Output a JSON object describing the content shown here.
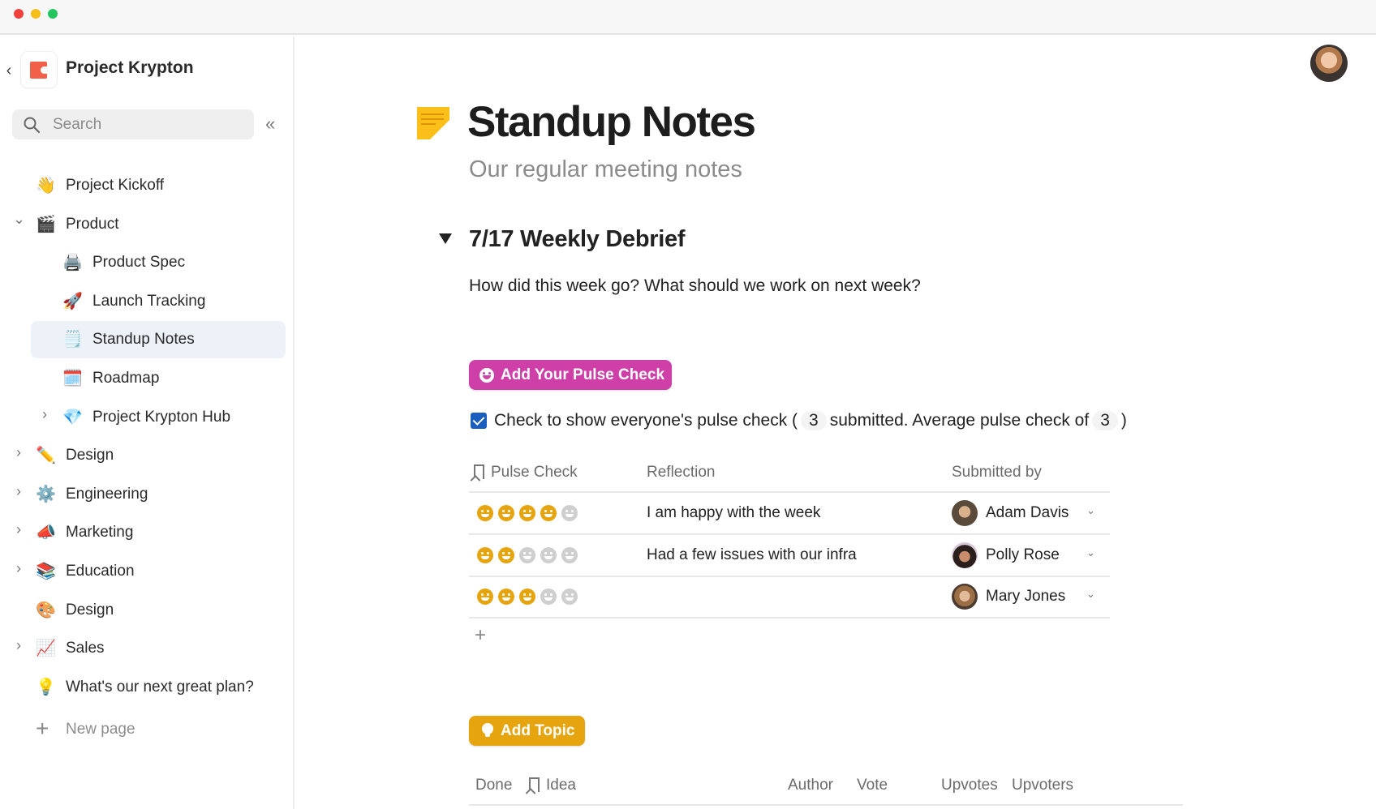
{
  "window": {
    "controls": [
      "close",
      "minimize",
      "zoom"
    ]
  },
  "sidebar": {
    "workspace_name": "Project Krypton",
    "back_icon": "chevron-left-icon",
    "logo_icon": "coda-logo-icon",
    "search_placeholder": "Search",
    "collapse_icon": "double-chevron-left-icon",
    "items": [
      {
        "label": "Project Kickoff",
        "icon": "👋",
        "icon_name": "waving-hand-icon",
        "level": 0,
        "chevron": null,
        "active": false
      },
      {
        "label": "Product",
        "icon": "🎬",
        "icon_name": "clapper-board-icon",
        "level": 0,
        "chevron": "expanded",
        "active": false
      },
      {
        "label": "Product Spec",
        "icon": "🖨️",
        "icon_name": "typewriter-icon",
        "level": 1,
        "chevron": null,
        "active": false
      },
      {
        "label": "Launch Tracking",
        "icon": "🚀",
        "icon_name": "rocket-icon",
        "level": 1,
        "chevron": null,
        "active": false
      },
      {
        "label": "Standup Notes",
        "icon": "🗒️",
        "icon_name": "sticky-note-icon",
        "level": 1,
        "chevron": null,
        "active": true
      },
      {
        "label": "Roadmap",
        "icon": "🗓️",
        "icon_name": "calendar-grid-icon",
        "level": 1,
        "chevron": null,
        "active": false
      },
      {
        "label": "Project Krypton Hub",
        "icon": "💎",
        "icon_name": "gem-icon",
        "level": 1,
        "chevron": "collapsed",
        "active": false
      },
      {
        "label": "Design",
        "icon": "✏️",
        "icon_name": "pencil-ruler-icon",
        "level": 0,
        "chevron": "collapsed",
        "active": false
      },
      {
        "label": "Engineering",
        "icon": "⚙️",
        "icon_name": "gear-icon",
        "level": 0,
        "chevron": "collapsed",
        "active": false
      },
      {
        "label": "Marketing",
        "icon": "📣",
        "icon_name": "megaphone-icon",
        "level": 0,
        "chevron": "collapsed",
        "active": false
      },
      {
        "label": "Education",
        "icon": "📚",
        "icon_name": "books-icon",
        "level": 0,
        "chevron": "collapsed",
        "active": false
      },
      {
        "label": "Design",
        "icon": "🎨",
        "icon_name": "color-grid-icon",
        "level": 0,
        "chevron": null,
        "active": false
      },
      {
        "label": "Sales",
        "icon": "📈",
        "icon_name": "chart-up-icon",
        "level": 0,
        "chevron": "collapsed",
        "active": false
      },
      {
        "label": "What's our next great plan?",
        "icon": "💡",
        "icon_name": "lightbulb-icon",
        "level": 0,
        "chevron": null,
        "active": false
      }
    ],
    "new_page_label": "New page"
  },
  "header": {
    "user_avatar": "user-avatar"
  },
  "page": {
    "title": "Standup Notes",
    "subtitle": "Our regular meeting notes",
    "section": {
      "title": "7/17 Weekly Debrief",
      "expanded": true,
      "prompt": "How did this week go? What should we work on next week?"
    },
    "pulse_button_label": "Add Your Pulse Check",
    "pulse_summary": {
      "checked": true,
      "prefix": "Check to show everyone's pulse check (",
      "submitted_count": "3",
      "middle": "submitted. Average pulse check of",
      "average": "3",
      "suffix": ")"
    },
    "pulse_table": {
      "columns": [
        "Pulse Check",
        "Reflection",
        "Submitted by"
      ],
      "rows": [
        {
          "pulse": 4,
          "max": 5,
          "reflection": "I am happy with the week",
          "submitted_by": "Adam Davis"
        },
        {
          "pulse": 2,
          "max": 5,
          "reflection": "Had a few issues with our infra",
          "submitted_by": "Polly Rose"
        },
        {
          "pulse": 3,
          "max": 5,
          "reflection": "",
          "submitted_by": "Mary Jones"
        }
      ],
      "add_row_label": "+"
    },
    "topic_button_label": "Add Topic",
    "topic_table": {
      "columns": [
        "Done",
        "Idea",
        "Author",
        "Vote",
        "Upvotes",
        "Upvoters"
      ]
    }
  },
  "colors": {
    "pulse_button": "#cf3fa8",
    "topic_button": "#e6a50f",
    "face_on": "#e6a50f",
    "face_off": "#cfcfcf",
    "checkbox": "#1a5fbf",
    "active_nav_bg": "#edf2f8"
  }
}
